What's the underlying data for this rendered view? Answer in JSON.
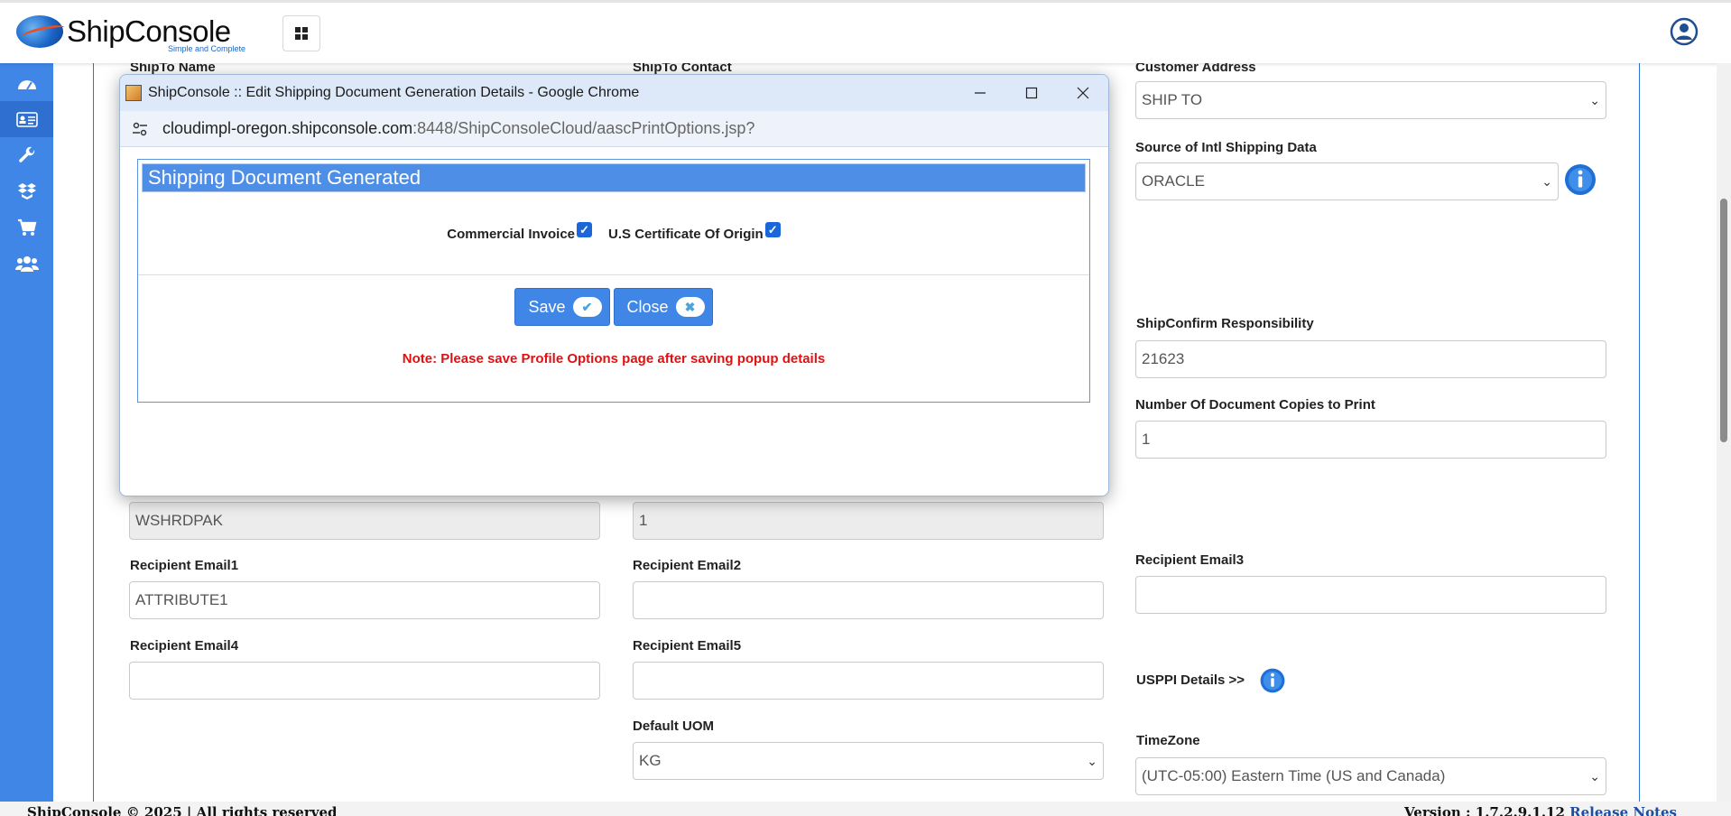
{
  "header": {
    "logo_main": "ShipConsole",
    "logo_tagline": "Simple and Complete"
  },
  "sidebar": {
    "items": [
      {
        "icon": "dashboard-icon"
      },
      {
        "icon": "id-card-icon"
      },
      {
        "icon": "wrench-icon"
      },
      {
        "icon": "boxes-icon"
      },
      {
        "icon": "cart-icon"
      },
      {
        "icon": "users-icon"
      }
    ]
  },
  "form": {
    "shipto_name_label": "ShipTo Name",
    "shipto_contact_label": "ShipTo Contact",
    "customer_address_label": "Customer Address",
    "customer_address_value": "SHIP TO",
    "source_intl_label": "Source of Intl Shipping Data",
    "source_intl_value": "ORACLE",
    "shipconfirm_label": "ShipConfirm Responsibility",
    "shipconfirm_value": "21623",
    "doc_copies_label": "Number Of Document Copies to Print",
    "doc_copies_value": "1",
    "field_a_value": "WSHRDPAK",
    "field_b_value": "1",
    "email1_label": "Recipient Email1",
    "email1_value": "ATTRIBUTE1",
    "email2_label": "Recipient Email2",
    "email2_value": "",
    "email3_label": "Recipient Email3",
    "email3_value": "",
    "email4_label": "Recipient Email4",
    "email4_value": "",
    "email5_label": "Recipient Email5",
    "email5_value": "",
    "usppi_label": "USPPI Details >>",
    "default_uom_label": "Default UOM",
    "default_uom_value": "KG",
    "timezone_label": "TimeZone",
    "timezone_value": "(UTC-05:00) Eastern Time (US and Canada)"
  },
  "popup": {
    "window_title": "ShipConsole :: Edit Shipping Document Generation Details - Google Chrome",
    "url_host": "cloudimpl-oregon.shipconsole.com",
    "url_path": ":8448/ShipConsoleCloud/aascPrintOptions.jsp?",
    "heading": "Shipping Document Generated",
    "options": [
      {
        "label": "Commercial Invoice",
        "checked": true
      },
      {
        "label": "U.S Certificate Of Origin",
        "checked": true
      }
    ],
    "save_label": "Save",
    "close_label": "Close",
    "note": "Note: Please save Profile Options page after saving popup details"
  },
  "footer": {
    "copyright": "ShipConsole © 2025 | All rights reserved",
    "version": "Version : 1.7.2.9.1.12",
    "release_notes": "Release Notes"
  },
  "colors": {
    "primary": "#3f86e6",
    "note_red": "#e01111"
  }
}
